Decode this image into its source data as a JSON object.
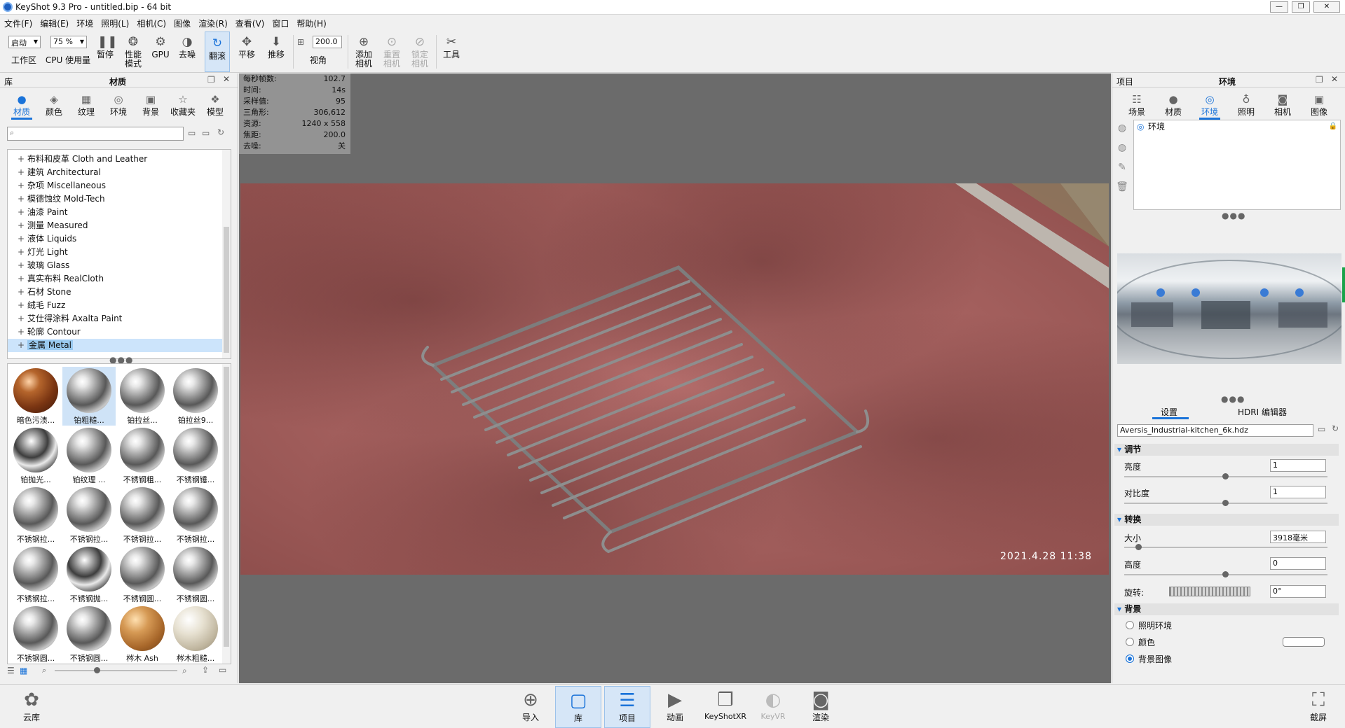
{
  "window": {
    "title": "KeyShot 9.3 Pro  - untitled.bip  - 64 bit",
    "min": "—",
    "max": "❐",
    "close": "✕"
  },
  "menu": [
    "文件(F)",
    "编辑(E)",
    "环境",
    "照明(L)",
    "相机(C)",
    "图像",
    "渲染(R)",
    "查看(V)",
    "窗口",
    "帮助(H)"
  ],
  "toolbar": {
    "workspace_select": "启动",
    "cpu_select": "75 %",
    "fov_value": "200.0",
    "workspace": "工作区",
    "cpu_usage": "CPU 使用量",
    "pause": "暂停",
    "performance_mode": "性能\n模式",
    "gpu": "GPU",
    "denoise": "去噪",
    "tumble": "翻滚",
    "pan": "平移",
    "dolly": "推移",
    "view_angle": "视角",
    "add_camera": "添加\n相机",
    "reset_camera": "重置\n相机",
    "lock_camera": "锁定\n相机",
    "tools": "工具"
  },
  "library": {
    "header_left": "库",
    "header_title": "材质",
    "tabs": [
      "材质",
      "颜色",
      "纹理",
      "环境",
      "背景",
      "收藏夹",
      "模型"
    ],
    "search_placeholder": "",
    "tree": [
      "布料和皮革 Cloth and Leather",
      "建筑 Architectural",
      "杂项 Miscellaneous",
      "模德蚀纹 Mold-Tech",
      "油漆 Paint",
      "测量 Measured",
      "液体 Liquids",
      "灯光 Light",
      "玻璃 Glass",
      "真实布料 RealCloth",
      "石材 Stone",
      "绒毛 Fuzz",
      "艾仕得涂料 Axalta Paint",
      "轮廓 Contour",
      "金属 Metal"
    ],
    "selected_tree": "金属 Metal",
    "thumbnails": [
      "暗色污渍...",
      "铂粗糙...",
      "铂拉丝...",
      "铂拉丝9...",
      "铂抛光...",
      "铂纹理 ...",
      "不锈钢粗...",
      "不锈钢锤...",
      "不锈钢拉...",
      "不锈钢拉...",
      "不锈钢拉...",
      "不锈钢拉...",
      "不锈钢拉...",
      "不锈钢抛...",
      "不锈钢圆...",
      "不锈钢圆...",
      "不锈钢圆...",
      "不锈钢圆...",
      "梣木 Ash",
      "梣木粗糙..."
    ]
  },
  "hud": [
    {
      "k": "每秒帧数:",
      "v": "102.7"
    },
    {
      "k": "时间:",
      "v": "14s"
    },
    {
      "k": "采样值:",
      "v": "95"
    },
    {
      "k": "三角形:",
      "v": "306,612"
    },
    {
      "k": "资源:",
      "v": "1240 x 558"
    },
    {
      "k": "焦距:",
      "v": "200.0"
    },
    {
      "k": "去噪:",
      "v": "关"
    }
  ],
  "viewport": {
    "timestamp": "2021.4.28 11:38"
  },
  "project": {
    "header_left": "项目",
    "header_title": "环境",
    "tabs": [
      "场景",
      "材质",
      "环境",
      "照明",
      "相机",
      "图像"
    ],
    "env_item": "环境",
    "subtabs": [
      "设置",
      "HDRI 编辑器"
    ],
    "hdri_file": "Aversis_Industrial-kitchen_6k.hdz",
    "sections": {
      "adjust": "调节",
      "transform": "转换",
      "background": "背景"
    },
    "brightness_label": "亮度",
    "brightness_value": "1",
    "contrast_label": "对比度",
    "contrast_value": "1",
    "size_label": "大小",
    "size_value": "3918毫米",
    "height_label": "高度",
    "height_value": "0",
    "rotation_label": "旋转:",
    "rotation_value": "0°",
    "bg_options": [
      "照明环境",
      "颜色",
      "背景图像"
    ],
    "bg_selected": "背景图像"
  },
  "bottom": {
    "cloud": "云库",
    "import": "导入",
    "library": "库",
    "project": "项目",
    "animation": "动画",
    "keyshotxr": "KeyShotXR",
    "keyvr": "KeyVR",
    "render": "渲染",
    "screenshot": "截屏"
  }
}
